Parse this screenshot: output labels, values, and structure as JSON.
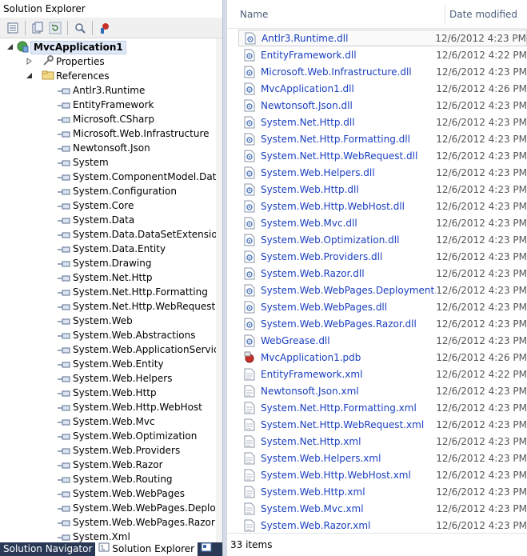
{
  "solution_explorer": {
    "title": "Solution Explorer",
    "toolbar": [
      "properties-icon",
      "show-all-files-icon",
      "refresh-icon",
      "view-class-diagram-icon",
      "pending-changes-icon"
    ],
    "project": "MvcApplication1",
    "properties_label": "Properties",
    "references_label": "References",
    "references": [
      "Antlr3.Runtime",
      "EntityFramework",
      "Microsoft.CSharp",
      "Microsoft.Web.Infrastructure",
      "Newtonsoft.Json",
      "System",
      "System.ComponentModel.DataAnnotations",
      "System.Configuration",
      "System.Core",
      "System.Data",
      "System.Data.DataSetExtensions",
      "System.Data.Entity",
      "System.Drawing",
      "System.Net.Http",
      "System.Net.Http.Formatting",
      "System.Net.Http.WebRequest",
      "System.Web",
      "System.Web.Abstractions",
      "System.Web.ApplicationServices",
      "System.Web.Entity",
      "System.Web.Helpers",
      "System.Web.Http",
      "System.Web.Http.WebHost",
      "System.Web.Mvc",
      "System.Web.Optimization",
      "System.Web.Providers",
      "System.Web.Razor",
      "System.Web.Routing",
      "System.Web.WebPages",
      "System.Web.WebPages.Deployment",
      "System.Web.WebPages.Razor",
      "System.Xml"
    ],
    "tabs": [
      "Solution Navigator",
      "Solution Explorer"
    ]
  },
  "file_list": {
    "columns": {
      "name": "Name",
      "date": "Date modified"
    },
    "files": [
      {
        "name": "Antlr3.Runtime.dll",
        "date": "12/6/2012 4:23 PM",
        "type": "dll"
      },
      {
        "name": "EntityFramework.dll",
        "date": "12/6/2012 4:22 PM",
        "type": "dll"
      },
      {
        "name": "Microsoft.Web.Infrastructure.dll",
        "date": "12/6/2012 4:23 PM",
        "type": "dll"
      },
      {
        "name": "MvcApplication1.dll",
        "date": "12/6/2012 4:26 PM",
        "type": "dll"
      },
      {
        "name": "Newtonsoft.Json.dll",
        "date": "12/6/2012 4:23 PM",
        "type": "dll"
      },
      {
        "name": "System.Net.Http.dll",
        "date": "12/6/2012 4:23 PM",
        "type": "dll"
      },
      {
        "name": "System.Net.Http.Formatting.dll",
        "date": "12/6/2012 4:23 PM",
        "type": "dll"
      },
      {
        "name": "System.Net.Http.WebRequest.dll",
        "date": "12/6/2012 4:23 PM",
        "type": "dll"
      },
      {
        "name": "System.Web.Helpers.dll",
        "date": "12/6/2012 4:23 PM",
        "type": "dll"
      },
      {
        "name": "System.Web.Http.dll",
        "date": "12/6/2012 4:23 PM",
        "type": "dll"
      },
      {
        "name": "System.Web.Http.WebHost.dll",
        "date": "12/6/2012 4:23 PM",
        "type": "dll"
      },
      {
        "name": "System.Web.Mvc.dll",
        "date": "12/6/2012 4:23 PM",
        "type": "dll"
      },
      {
        "name": "System.Web.Optimization.dll",
        "date": "12/6/2012 4:23 PM",
        "type": "dll"
      },
      {
        "name": "System.Web.Providers.dll",
        "date": "12/6/2012 4:23 PM",
        "type": "dll"
      },
      {
        "name": "System.Web.Razor.dll",
        "date": "12/6/2012 4:23 PM",
        "type": "dll"
      },
      {
        "name": "System.Web.WebPages.Deployment.dll",
        "date": "12/6/2012 4:23 PM",
        "type": "dll"
      },
      {
        "name": "System.Web.WebPages.dll",
        "date": "12/6/2012 4:23 PM",
        "type": "dll"
      },
      {
        "name": "System.Web.WebPages.Razor.dll",
        "date": "12/6/2012 4:23 PM",
        "type": "dll"
      },
      {
        "name": "WebGrease.dll",
        "date": "12/6/2012 4:23 PM",
        "type": "dll"
      },
      {
        "name": "MvcApplication1.pdb",
        "date": "12/6/2012 4:26 PM",
        "type": "pdb"
      },
      {
        "name": "EntityFramework.xml",
        "date": "12/6/2012 4:22 PM",
        "type": "xml"
      },
      {
        "name": "Newtonsoft.Json.xml",
        "date": "12/6/2012 4:23 PM",
        "type": "xml"
      },
      {
        "name": "System.Net.Http.Formatting.xml",
        "date": "12/6/2012 4:23 PM",
        "type": "xml"
      },
      {
        "name": "System.Net.Http.WebRequest.xml",
        "date": "12/6/2012 4:23 PM",
        "type": "xml"
      },
      {
        "name": "System.Net.Http.xml",
        "date": "12/6/2012 4:23 PM",
        "type": "xml"
      },
      {
        "name": "System.Web.Helpers.xml",
        "date": "12/6/2012 4:23 PM",
        "type": "xml"
      },
      {
        "name": "System.Web.Http.WebHost.xml",
        "date": "12/6/2012 4:23 PM",
        "type": "xml"
      },
      {
        "name": "System.Web.Http.xml",
        "date": "12/6/2012 4:23 PM",
        "type": "xml"
      },
      {
        "name": "System.Web.Mvc.xml",
        "date": "12/6/2012 4:23 PM",
        "type": "xml"
      },
      {
        "name": "System.Web.Razor.xml",
        "date": "12/6/2012 4:23 PM",
        "type": "xml"
      }
    ],
    "status": "33 items"
  },
  "colors": {
    "link_blue": "#1a3fbf",
    "tab_bar": "#293955",
    "header_text": "#4c607a"
  }
}
